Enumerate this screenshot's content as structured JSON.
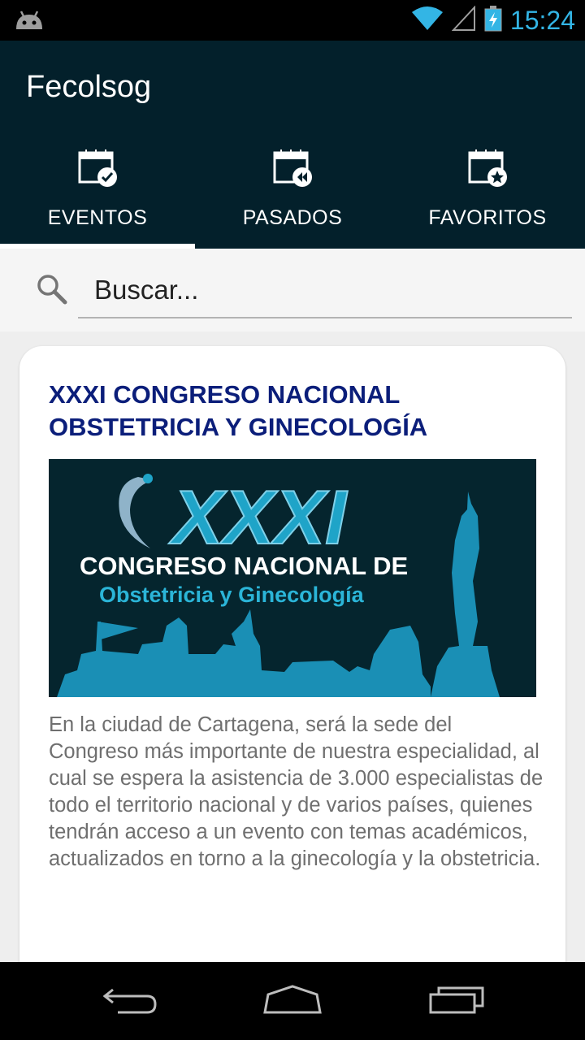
{
  "status_bar": {
    "time": "15:24",
    "icons": [
      "android-icon",
      "wifi-icon",
      "signal-icon",
      "battery-charging-icon"
    ],
    "accent": "#33b5e5"
  },
  "app": {
    "title": "Fecolsog",
    "bar_color": "#03202b"
  },
  "tabs": [
    {
      "label": "EVENTOS",
      "icon": "calendar-check-icon",
      "selected": true
    },
    {
      "label": "PASADOS",
      "icon": "calendar-rewind-icon",
      "selected": false
    },
    {
      "label": "FAVORITOS",
      "icon": "calendar-star-icon",
      "selected": false
    }
  ],
  "search": {
    "placeholder": "Buscar...",
    "value": ""
  },
  "event": {
    "title": "XXXI CONGRESO NACIONAL OBSTETRICIA Y GINECOLOGÍA",
    "banner": {
      "numeral": "XXXI",
      "line1": "CONGRESO NACIONAL DE",
      "line2": "Obstetricia y Ginecología"
    },
    "description": "En la ciudad de Cartagena, será la sede del Congreso más importante de nuestra especialidad, al cual se espera la asistencia de 3.000 especialistas de todo el territorio nacional y de varios países, quienes tendrán acceso a un evento con temas académicos, actualizados en torno a la ginecología y la obstetricia.",
    "title_color": "#0b1e7a"
  },
  "nav_bar": {
    "buttons": [
      "back-icon",
      "home-icon",
      "recent-apps-icon"
    ]
  }
}
